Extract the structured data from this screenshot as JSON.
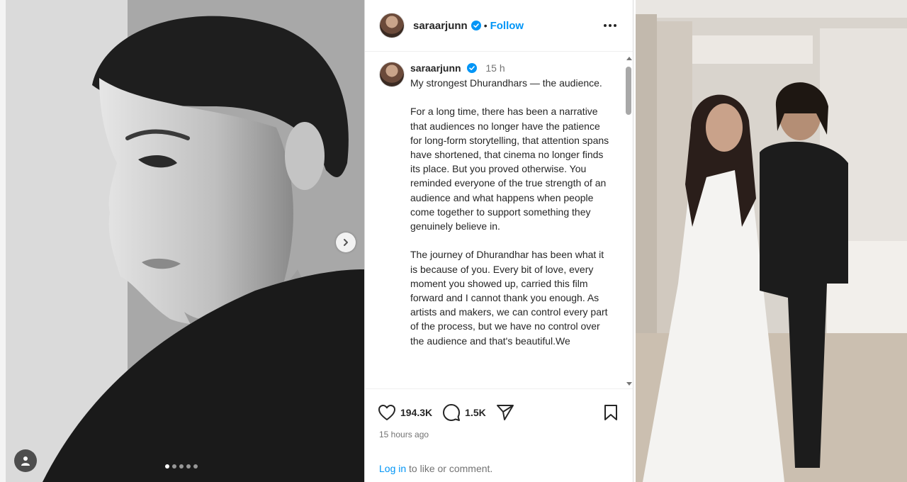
{
  "left_photo": {
    "carousel": {
      "dot_count": 5,
      "active_index": 0
    }
  },
  "post": {
    "header": {
      "username": "saraarjunn",
      "separator": "•",
      "follow_label": "Follow"
    },
    "caption": {
      "username": "saraarjunn",
      "time": "15 h",
      "paragraphs": [
        "My strongest Dhurandhars — the audience.",
        "For a long time, there has been a narrative that audiences no longer have the patience for long-form storytelling, that attention spans have shortened, that cinema no longer finds its place. But you proved otherwise. You reminded everyone of the true strength of an audience and what happens when people come together to support something they genuinely believe in.",
        "The journey of Dhurandhar has been what it is because of you. Every bit of love, every moment you showed up, carried this film forward and I cannot thank you enough. As artists and makers, we can control every part of the process, but we have no control over the audience and that's beautiful.We"
      ]
    },
    "actions": {
      "likes": "194.3K",
      "comments": "1.5K"
    },
    "timestamp": "15 hours ago",
    "login_prompt": {
      "link": "Log in",
      "rest": " to like or comment."
    }
  },
  "colors": {
    "accent_blue": "#0095f6",
    "text": "#262626",
    "muted": "#737373"
  },
  "icons": [
    "chevron-right-icon",
    "user-tag-icon",
    "verified-icon",
    "more-icon",
    "heart-icon",
    "comment-icon",
    "share-icon",
    "bookmark-icon"
  ]
}
